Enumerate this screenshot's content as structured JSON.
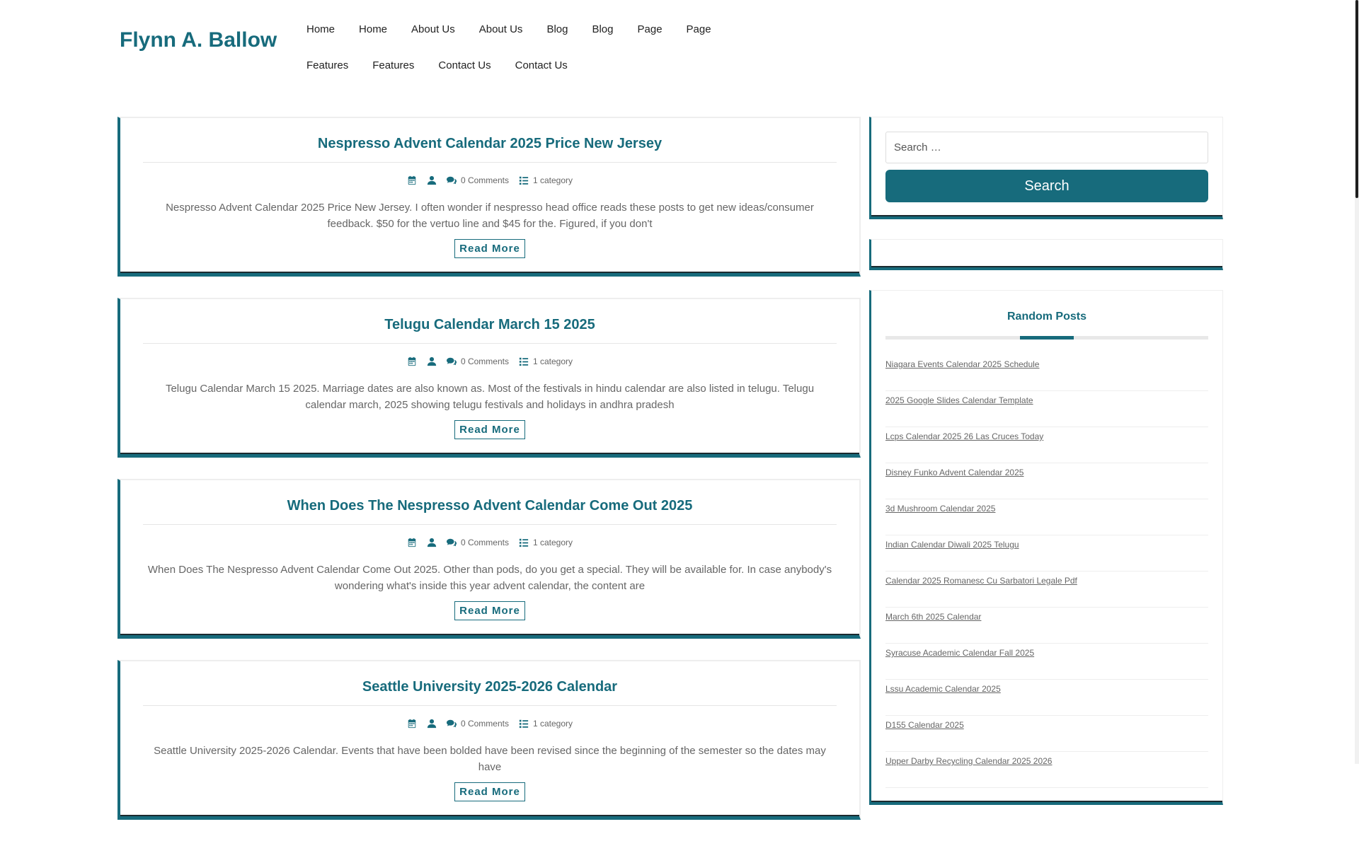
{
  "site": {
    "title": "Flynn A. Ballow"
  },
  "nav": {
    "row1": [
      "Home",
      "Home",
      "About Us",
      "About Us",
      "Blog",
      "Blog",
      "Page",
      "Page"
    ],
    "row2": [
      "Features",
      "Features",
      "Contact Us",
      "Contact Us"
    ]
  },
  "posts": [
    {
      "title": "Nespresso Advent Calendar 2025 Price New Jersey",
      "comments": "0 Comments",
      "category": "1 category",
      "excerpt": "Nespresso Advent Calendar 2025 Price New Jersey. I often wonder if nespresso head office reads these posts to get new ideas/consumer feedback. $50 for the vertuo line and $45 for the. Figured, if you don't",
      "read_more": "Read More"
    },
    {
      "title": "Telugu Calendar March 15 2025",
      "comments": "0 Comments",
      "category": "1 category",
      "excerpt": "Telugu Calendar March 15 2025. Marriage dates are also known as. Most of the festivals in hindu calendar are also listed in telugu. Telugu calendar march, 2025 showing telugu festivals and holidays in andhra pradesh",
      "read_more": "Read More"
    },
    {
      "title": "When Does The Nespresso Advent Calendar Come Out 2025",
      "comments": "0 Comments",
      "category": "1 category",
      "excerpt": "When Does The Nespresso Advent Calendar Come Out 2025. Other than pods, do you get a special. They will be available for. In case anybody's wondering what's inside this year advent calendar, the content are",
      "read_more": "Read More"
    },
    {
      "title": "Seattle University 2025-2026 Calendar",
      "comments": "0 Comments",
      "category": "1 category",
      "excerpt": "Seattle University 2025-2026 Calendar. Events that have been bolded have been revised since the beginning of the semester so the dates may have",
      "read_more": "Read More"
    }
  ],
  "sidebar": {
    "search": {
      "placeholder": "Search …",
      "button": "Search"
    },
    "random_posts": {
      "title": "Random Posts",
      "items": [
        "Niagara Events Calendar 2025 Schedule",
        "2025 Google Slides Calendar Template",
        "Lcps Calendar 2025 26 Las Cruces Today",
        "Disney Funko Advent Calendar 2025",
        "3d Mushroom Calendar 2025",
        "Indian Calendar Diwali 2025 Telugu",
        "Calendar 2025 Romanesc Cu Sarbatori Legale Pdf",
        "March 6th 2025 Calendar",
        "Syracuse Academic Calendar Fall 2025",
        "Lssu Academic Calendar 2025",
        "D155 Calendar 2025",
        "Upper Darby Recycling Calendar 2025 2026"
      ]
    }
  },
  "icons": {
    "date": "calendar-icon",
    "author": "user-icon",
    "comments": "comments-icon",
    "category": "list-icon"
  },
  "colors": {
    "accent": "#176b7c",
    "dark_edge": "#1b2a2f"
  }
}
